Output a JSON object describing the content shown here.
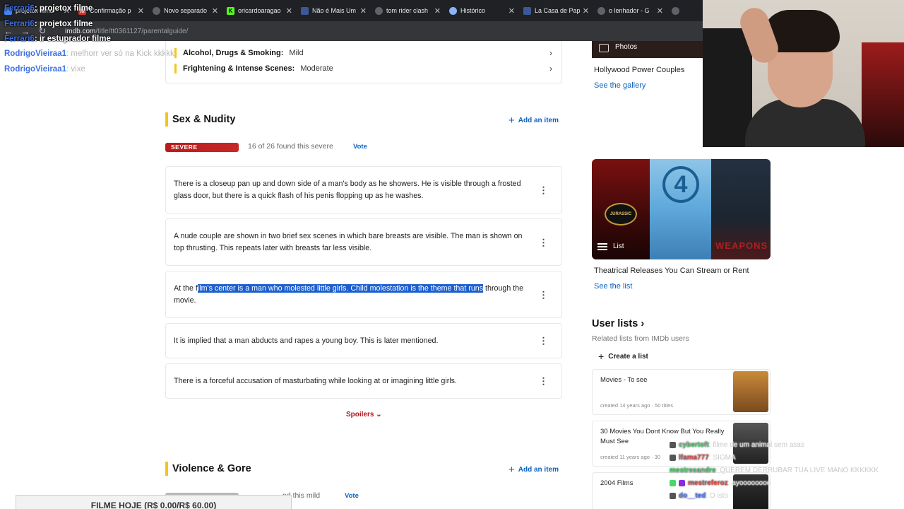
{
  "browser": {
    "tabs": [
      {
        "label": "projetox filme",
        "color": "#4285f4"
      },
      {
        "label": "Confirmação p",
        "color": "#d93025"
      },
      {
        "label": "Novo separado",
        "color": "#5f6368"
      },
      {
        "label": "oricardoaragao",
        "color": "#53fc18"
      },
      {
        "label": "Não é Mais Um",
        "color": "#3b5998"
      },
      {
        "label": "tom rider clash",
        "color": "#5f6368"
      },
      {
        "label": "Histórico",
        "color": "#8ab4f8"
      },
      {
        "label": "La Casa de Pap",
        "color": "#3b5998"
      },
      {
        "label": "o lenhador - G",
        "color": "#5f6368"
      }
    ],
    "url_domain": "imdb.com",
    "url_path": "/title/tt0361127/parentalguide/"
  },
  "chat_top": [
    {
      "user": "Ferrari6",
      "message": ": projetox filme"
    },
    {
      "user": "Ferrari6",
      "message": ": projetox filme"
    },
    {
      "user": "Ferrari6",
      "message": ": ir estuprador filme"
    },
    {
      "user": "RodrigoVieiraa1",
      "message": ": melhorr ver só na Kick kkkkk"
    },
    {
      "user": "RodrigoVieiraa1",
      "message": ": vixe"
    }
  ],
  "ratings_top": [
    {
      "label": "Alcohol, Drugs & Smoking:",
      "value": "Mild"
    },
    {
      "label": "Frightening & Intense Scenes:",
      "value": "Moderate"
    }
  ],
  "sex_nudity": {
    "title": "Sex & Nudity",
    "add_item": "Add an item",
    "severity": "SEVERE",
    "found_text": "16 of 26 found this severe",
    "vote": "Vote",
    "entries": [
      "There is a closeup pan up and down side of a man's body as he showers. He is visible through a frosted glass door, but there is a quick flash of his penis flopping up as he washes.",
      "A nude couple are shown in two brief sex scenes in which bare breasts are visible. The man is shown on top thrusting. This repeats later with breasts far less visible.",
      "It is implied that a man abducts and rapes a young boy. This is later mentioned.",
      "There is a forceful accusation of masturbating while looking at or imagining little girls."
    ],
    "entry3_before": "At the f",
    "entry3_highlight": "ilm's center is a man who molested little girls. Child molestation is the theme that runs",
    "entry3_after": " through the movie.",
    "spoilers": "Spoilers"
  },
  "violence_gore": {
    "title": "Violence & Gore",
    "add_item": "Add an item",
    "found_partial": "nd this mild",
    "vote": "Vote"
  },
  "sidebar": {
    "photos_label": "Photos",
    "photos_title": "Hollywood Power Couples",
    "photos_link": "See the gallery",
    "list_badge": "List",
    "list_title": "Theatrical Releases You Can Stream or Rent",
    "list_link": "See the list",
    "user_lists_title": "User lists",
    "user_lists_sub": "Related lists from IMDb users",
    "create_list": "Create a list",
    "cards": [
      {
        "title": "Movies - To see",
        "meta": "created 14 years ago · 50 titles"
      },
      {
        "title": "30 Movies You Dont Know But You Really Must See",
        "meta": "created 11 years ago · 30"
      },
      {
        "title": "2004 Films",
        "meta": ""
      }
    ]
  },
  "chat_bottom": [
    {
      "user": "cybertoft",
      "message": ": filme de um animal sem asas",
      "color": "#4ad66d"
    },
    {
      "user": "lfama777",
      "message": ": SIGMA",
      "color": "#e05555"
    },
    {
      "user": "mestreeandre",
      "message": ": QUEREM DERRUBAR TUA LIVE MANO KKKKKK",
      "color": "#4ad66d"
    },
    {
      "user": "mestreferoz",
      "message": ": ayoooooooo",
      "color": "#d9534f"
    },
    {
      "user": "do__ted",
      "message": ": O isto",
      "color": "#5b7ce6"
    }
  ],
  "footer_bar": "FILME HOJE (R$ 0.00/R$ 60.00)"
}
